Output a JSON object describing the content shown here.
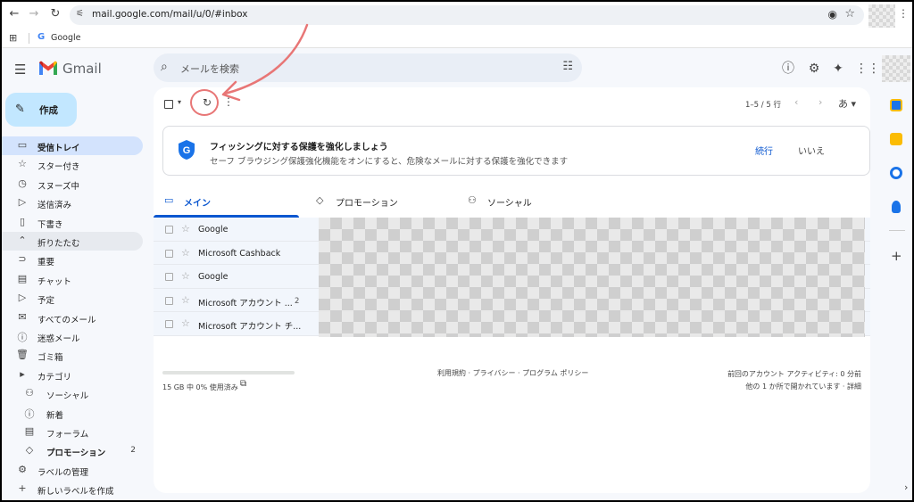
{
  "browser": {
    "url": "mail.google.com/mail/u/0/#inbox",
    "bookmark": "Google"
  },
  "header": {
    "app_name": "Gmail",
    "search_placeholder": "メールを検索"
  },
  "compose_label": "作成",
  "sidebar": {
    "items": [
      {
        "label": "受信トレイ",
        "icon": "inbox-icon",
        "glyph": "▭",
        "active": true
      },
      {
        "label": "スター付き",
        "icon": "star-icon",
        "glyph": "☆"
      },
      {
        "label": "スヌーズ中",
        "icon": "clock-icon",
        "glyph": "◷"
      },
      {
        "label": "送信済み",
        "icon": "send-icon",
        "glyph": "▷"
      },
      {
        "label": "下書き",
        "icon": "draft-icon",
        "glyph": "▯"
      },
      {
        "label": "折りたたむ",
        "icon": "chevron-up-icon",
        "glyph": "⌃",
        "collapse": true
      },
      {
        "label": "重要",
        "icon": "important-icon",
        "glyph": "⊃"
      },
      {
        "label": "チャット",
        "icon": "chat-icon",
        "glyph": "▤"
      },
      {
        "label": "予定",
        "icon": "scheduled-icon",
        "glyph": "▷"
      },
      {
        "label": "すべてのメール",
        "icon": "all-mail-icon",
        "glyph": "✉"
      },
      {
        "label": "迷惑メール",
        "icon": "spam-icon",
        "glyph": "ⓘ"
      },
      {
        "label": "ゴミ箱",
        "icon": "trash-icon",
        "glyph": "🗑"
      },
      {
        "label": "カテゴリ",
        "icon": "category-icon",
        "glyph": "▸"
      },
      {
        "label": "ソーシャル",
        "icon": "social-icon",
        "glyph": "⚇",
        "sub": true
      },
      {
        "label": "新着",
        "icon": "updates-icon",
        "glyph": "ⓘ",
        "sub": true
      },
      {
        "label": "フォーラム",
        "icon": "forums-icon",
        "glyph": "▤",
        "sub": true
      },
      {
        "label": "プロモーション",
        "icon": "promotions-icon",
        "glyph": "◇",
        "sub": true,
        "bold": true,
        "count": "2"
      },
      {
        "label": "ラベルの管理",
        "icon": "gear-icon",
        "glyph": "⚙"
      },
      {
        "label": "新しいラベルを作成",
        "icon": "plus-icon",
        "glyph": "+"
      }
    ]
  },
  "toolbar": {
    "pager": "1–5 / 5 行",
    "lang": "あ"
  },
  "banner": {
    "title": "フィッシングに対する保護を強化しましょう",
    "description": "セーフ ブラウジング保護強化機能をオンにすると、危険なメールに対する保護を強化できます",
    "continue_label": "続行",
    "dismiss_label": "いいえ"
  },
  "tabs": [
    {
      "label": "メイン",
      "icon": "inbox-icon",
      "active": true
    },
    {
      "label": "プロモーション",
      "icon": "tag-icon"
    },
    {
      "label": "ソーシャル",
      "icon": "people-icon"
    }
  ],
  "emails": [
    {
      "sender": "Google",
      "count": ""
    },
    {
      "sender": "Microsoft Cashback",
      "count": ""
    },
    {
      "sender": "Google",
      "count": ""
    },
    {
      "sender": "Microsoft アカウント ...",
      "count": "2"
    },
    {
      "sender": "Microsoft アカウント チ...",
      "count": ""
    }
  ],
  "footer": {
    "storage": "15 GB 中 0% 使用済み",
    "storage_used_percent": 0,
    "links": "利用規約 · プライバシー · プログラム ポリシー",
    "activity_line1": "前回のアカウント アクティビティ: 0 分前",
    "activity_line2": "他の 1 か所で開かれています · 詳細"
  },
  "colors": {
    "accent": "#0b57d0",
    "compose_bg": "#c2e7ff",
    "active_nav": "#d3e3fd",
    "annotation": "#e87676"
  }
}
